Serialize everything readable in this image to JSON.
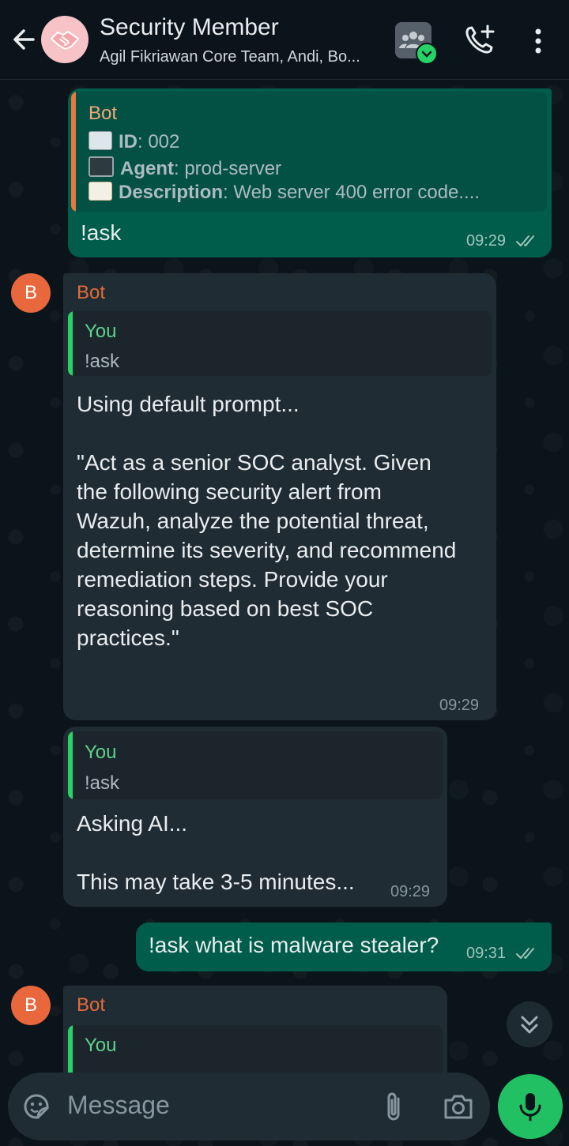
{
  "header": {
    "title": "Security Member",
    "subtitle": "Agil Fikriawan Core Team, Andi, Bo..."
  },
  "messages": {
    "m1": {
      "quote_name": "Bot",
      "quote_id_label": "ID",
      "quote_id_value": ": 002",
      "quote_agent_label": "Agent",
      "quote_agent_value": ": prod-server",
      "quote_desc_label": "Description",
      "quote_desc_value": ": Web server 400 error code....",
      "text": "!ask",
      "time": "09:29"
    },
    "m2": {
      "avatar_letter": "B",
      "sender": "Bot",
      "quote_name": "You",
      "quote_text": "!ask",
      "text": "Using default prompt...\n\n\"Act as a senior SOC analyst. Given\nthe following security alert from\nWazuh, analyze the potential threat,\ndetermine its severity, and recommend\nremediation steps. Provide your\nreasoning based on best SOC\npractices.\"",
      "time": "09:29"
    },
    "m3": {
      "quote_name": "You",
      "quote_text": "!ask",
      "text": "Asking AI...\n\nThis may take 3-5 minutes...",
      "time": "09:29"
    },
    "m4": {
      "text": "!ask what is malware stealer?",
      "time": "09:31"
    },
    "m5": {
      "avatar_letter": "B",
      "sender": "Bot",
      "quote_name": "You"
    }
  },
  "composer": {
    "placeholder": "Message"
  },
  "colors": {
    "outgoing_bubble": "#005c4b",
    "incoming_bubble": "#202c33",
    "accent_green": "#21c063",
    "bot_name": "#e26b3a",
    "you_name": "#53bdeb"
  }
}
